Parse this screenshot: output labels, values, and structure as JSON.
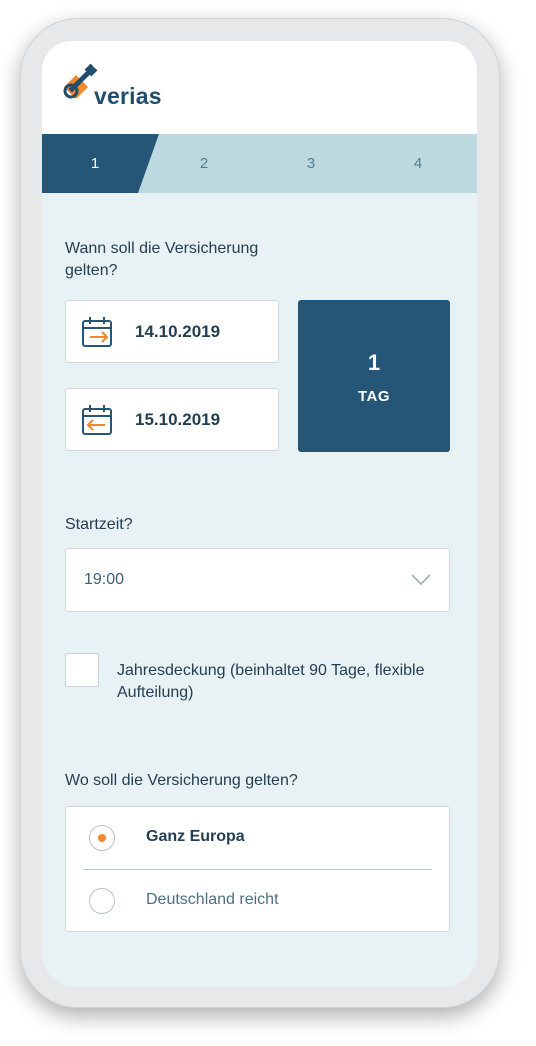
{
  "brand": {
    "name": "verias"
  },
  "stepper": {
    "steps": [
      "1",
      "2",
      "3",
      "4"
    ],
    "active": 1
  },
  "coverage_period": {
    "question": "Wann soll die Versicherung gelten?",
    "start_date": "14.10.2019",
    "end_date": "15.10.2019",
    "duration_value": "1",
    "duration_unit": "TAG",
    "start_icon": "calendar-arrow-right-icon",
    "end_icon": "calendar-arrow-left-icon"
  },
  "start_time": {
    "question": "Startzeit?",
    "value": "19:00",
    "icon": "chevron-down-icon"
  },
  "annual_cover": {
    "label": "Jahresdeckung (beinhaltet 90 Tage, flexible Aufteilung)",
    "checked": false
  },
  "region": {
    "question": "Wo soll die Versicherung gelten?",
    "options": [
      {
        "label": "Ganz Europa",
        "selected": true
      },
      {
        "label": "Deutschland reicht",
        "selected": false
      }
    ]
  },
  "colors": {
    "primary": "#265677",
    "accent": "#ef8a2e",
    "background": "#e8f1f3",
    "stepper_inactive": "#bdd9e0"
  }
}
